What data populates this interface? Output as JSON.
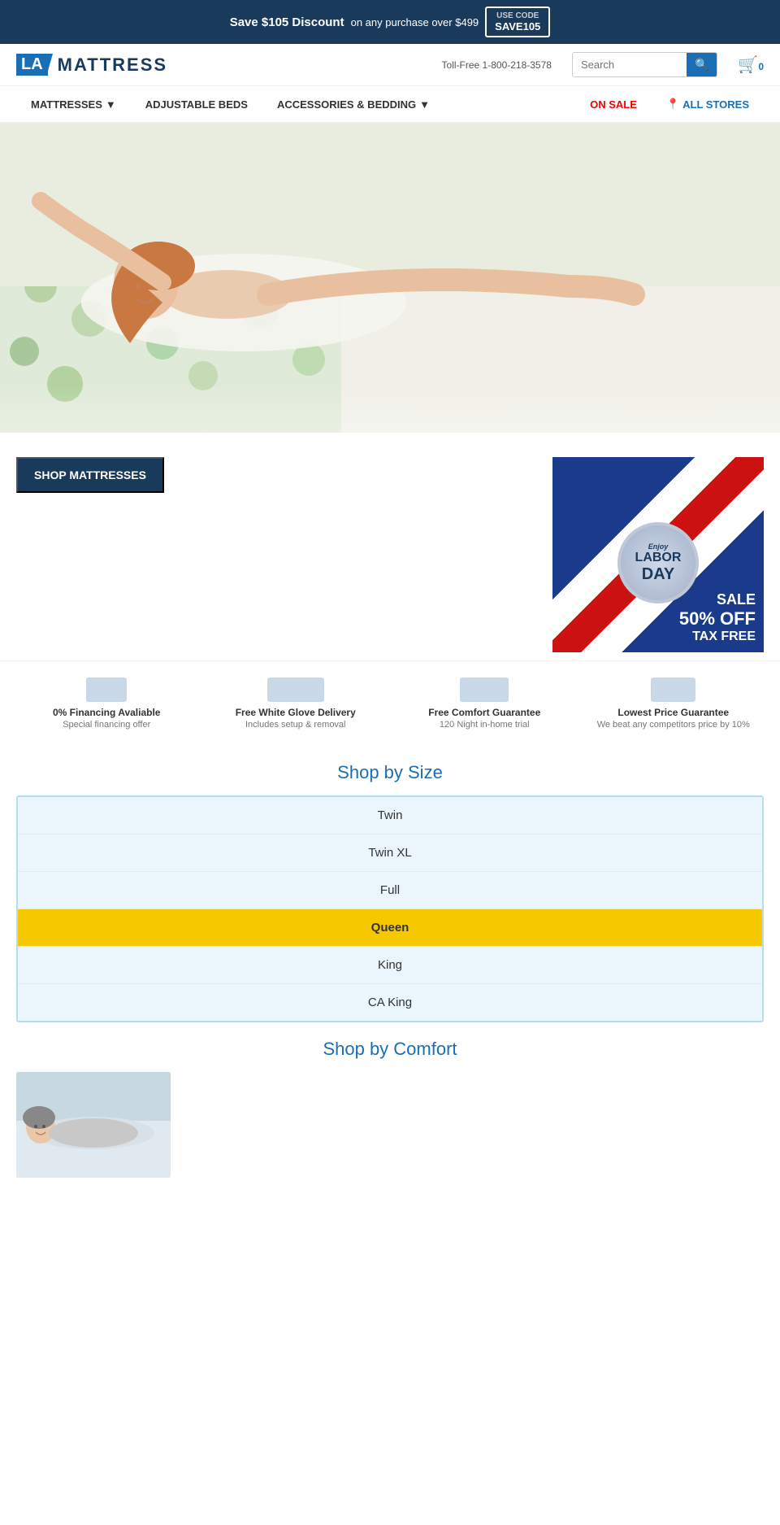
{
  "top_banner": {
    "save_text": "Save $105 Discount",
    "condition_text": "on any purchase over $499",
    "code_label": "USE CODE",
    "code_value": "SAVE105"
  },
  "header": {
    "logo_la": "LA",
    "logo_name": "MATTRESS",
    "phone": "Toll-Free 1-800-218-3578",
    "search_placeholder": "Search",
    "cart_count": "0"
  },
  "nav": {
    "items": [
      {
        "label": "MATTRESSES",
        "has_dropdown": true,
        "id": "mattresses"
      },
      {
        "label": "ADJUSTABLE BEDS",
        "has_dropdown": false,
        "id": "adjustable-beds"
      },
      {
        "label": "ACCESSORIES & BEDDING",
        "has_dropdown": true,
        "id": "accessories"
      },
      {
        "label": "ON SALE",
        "has_dropdown": false,
        "id": "on-sale",
        "style": "red"
      },
      {
        "label": "ALL STORES",
        "has_dropdown": false,
        "id": "all-stores",
        "style": "blue"
      }
    ]
  },
  "hero": {
    "alt": "Woman waking up happy in bed"
  },
  "shop_mattresses": {
    "button_label": "SHOP MATTRESSES"
  },
  "labor_day": {
    "enjoy_label": "Enjoy",
    "labor_label": "LABOR",
    "day_label": "DAY",
    "sale_label": "SALE",
    "percent_label": "50% OFF",
    "tax_label": "TAX FREE"
  },
  "features": [
    {
      "title": "0% Financing Avaliable",
      "subtitle": "Special financing offer"
    },
    {
      "title": "Free White Glove Delivery",
      "subtitle": "Includes setup & removal"
    },
    {
      "title": "Free Comfort Guarantee",
      "subtitle": "120 Night in-home trial"
    },
    {
      "title": "Lowest Price Guarantee",
      "subtitle": "We beat any competitors price by 10%"
    }
  ],
  "shop_by_size": {
    "title": "Shop by Size",
    "sizes": [
      {
        "label": "Twin",
        "active": false
      },
      {
        "label": "Twin XL",
        "active": false
      },
      {
        "label": "Full",
        "active": false
      },
      {
        "label": "Queen",
        "active": true
      },
      {
        "label": "King",
        "active": false
      },
      {
        "label": "CA King",
        "active": false
      }
    ]
  },
  "shop_by_comfort": {
    "title": "Shop by Comfort"
  }
}
